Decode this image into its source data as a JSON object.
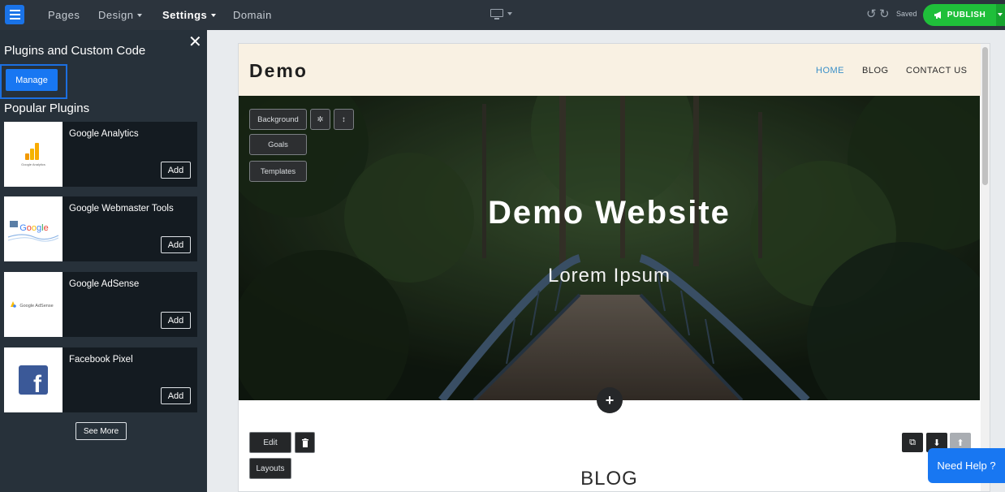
{
  "topbar": {
    "menu": [
      "Pages",
      "Design",
      "Settings",
      "Domain"
    ],
    "saved": "Saved",
    "publish": "PUBLISH"
  },
  "sidebar": {
    "title": "Plugins and Custom Code",
    "manage": "Manage",
    "popular": "Popular Plugins",
    "plugins": [
      {
        "name": "Google Analytics",
        "add": "Add",
        "thumb": "Google Analytics"
      },
      {
        "name": "Google Webmaster Tools",
        "add": "Add",
        "thumb": "Google"
      },
      {
        "name": "Google AdSense",
        "add": "Add",
        "thumb": "Google AdSense"
      },
      {
        "name": "Facebook Pixel",
        "add": "Add",
        "thumb": "f"
      }
    ],
    "see_more": "See More"
  },
  "site": {
    "logo": "Demo",
    "nav": [
      "HOME",
      "BLOG",
      "CONTACT US"
    ],
    "hero_title": "Demo Website",
    "hero_subtitle": "Lorem Ipsum",
    "tools": {
      "background": "Background",
      "goals": "Goals",
      "templates": "Templates",
      "edit": "Edit",
      "layouts": "Layouts"
    },
    "blog_title": "BLOG"
  },
  "help": "Need Help ?",
  "colors": {
    "accent": "#1877f2",
    "publish": "#1fbf3a",
    "topbar": "#2c343d",
    "sidebar": "#27313a"
  }
}
